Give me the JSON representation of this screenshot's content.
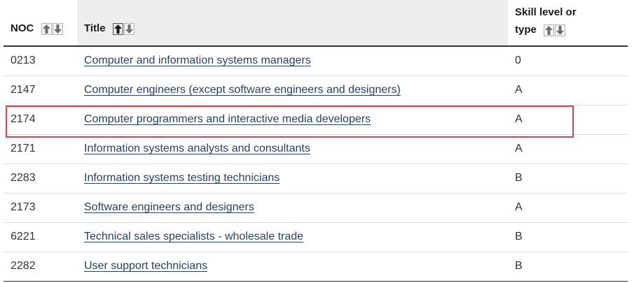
{
  "header": {
    "noc_label": "NOC",
    "title_label": "Title",
    "skill_label_line1": "Skill level or",
    "skill_label_line2": "type"
  },
  "sort_icons": {
    "up": "arrow-up-icon",
    "down": "arrow-down-icon",
    "active_column": "title",
    "active_direction": "ascending"
  },
  "rows": [
    {
      "noc": "0213",
      "title": "Computer and information systems managers",
      "skill": "0"
    },
    {
      "noc": "2147",
      "title": "Computer engineers (except software engineers and designers)",
      "skill": "A"
    },
    {
      "noc": "2174",
      "title": "Computer programmers and interactive media developers",
      "skill": "A"
    },
    {
      "noc": "2171",
      "title": "Information systems analysts and consultants",
      "skill": "A"
    },
    {
      "noc": "2283",
      "title": "Information systems testing technicians",
      "skill": "B"
    },
    {
      "noc": "2173",
      "title": "Software engineers and designers",
      "skill": "A"
    },
    {
      "noc": "6221",
      "title": "Technical sales specialists - wholesale trade",
      "skill": "B"
    },
    {
      "noc": "2282",
      "title": "User support technicians",
      "skill": "B"
    }
  ],
  "highlighted_row": 2,
  "colors": {
    "link": "#284162",
    "highlight_border": "#e04049",
    "header_active_bg": "#eeeeee"
  }
}
